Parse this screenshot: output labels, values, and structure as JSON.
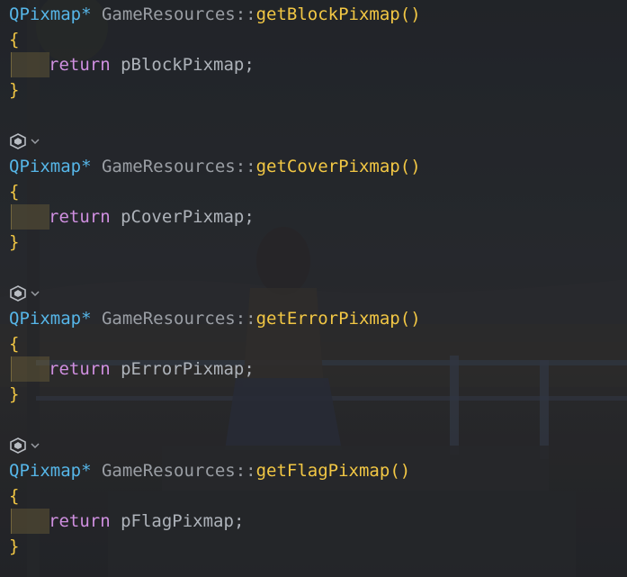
{
  "editor": {
    "functions": [
      {
        "return_type": "QPixmap",
        "pointer": "*",
        "class_name": "GameResources",
        "scope_op": "::",
        "func_name": "getBlockPixmap",
        "parens": "()",
        "open_brace": "{",
        "keyword": "return",
        "identifier": "pBlockPixmap",
        "semicolon": ";",
        "close_brace": "}"
      },
      {
        "return_type": "QPixmap",
        "pointer": "*",
        "class_name": "GameResources",
        "scope_op": "::",
        "func_name": "getCoverPixmap",
        "parens": "()",
        "open_brace": "{",
        "keyword": "return",
        "identifier": "pCoverPixmap",
        "semicolon": ";",
        "close_brace": "}"
      },
      {
        "return_type": "QPixmap",
        "pointer": "*",
        "class_name": "GameResources",
        "scope_op": "::",
        "func_name": "getErrorPixmap",
        "parens": "()",
        "open_brace": "{",
        "keyword": "return",
        "identifier": "pErrorPixmap",
        "semicolon": ";",
        "close_brace": "}"
      },
      {
        "return_type": "QPixmap",
        "pointer": "*",
        "class_name": "GameResources",
        "scope_op": "::",
        "func_name": "getFlagPixmap",
        "parens": "()",
        "open_brace": "{",
        "keyword": "return",
        "identifier": "pFlagPixmap",
        "semicolon": ";",
        "close_brace": "}"
      }
    ],
    "code_lens_icon": "ai-assistant-icon",
    "code_lens_chevron": "chevron-down-icon",
    "colors": {
      "type": "#56b6e8",
      "function": "#f2c744",
      "keyword": "#cf8fe0",
      "identifier": "#aeb3ba",
      "class": "#9a9ea4",
      "background": "#262a2e"
    }
  }
}
